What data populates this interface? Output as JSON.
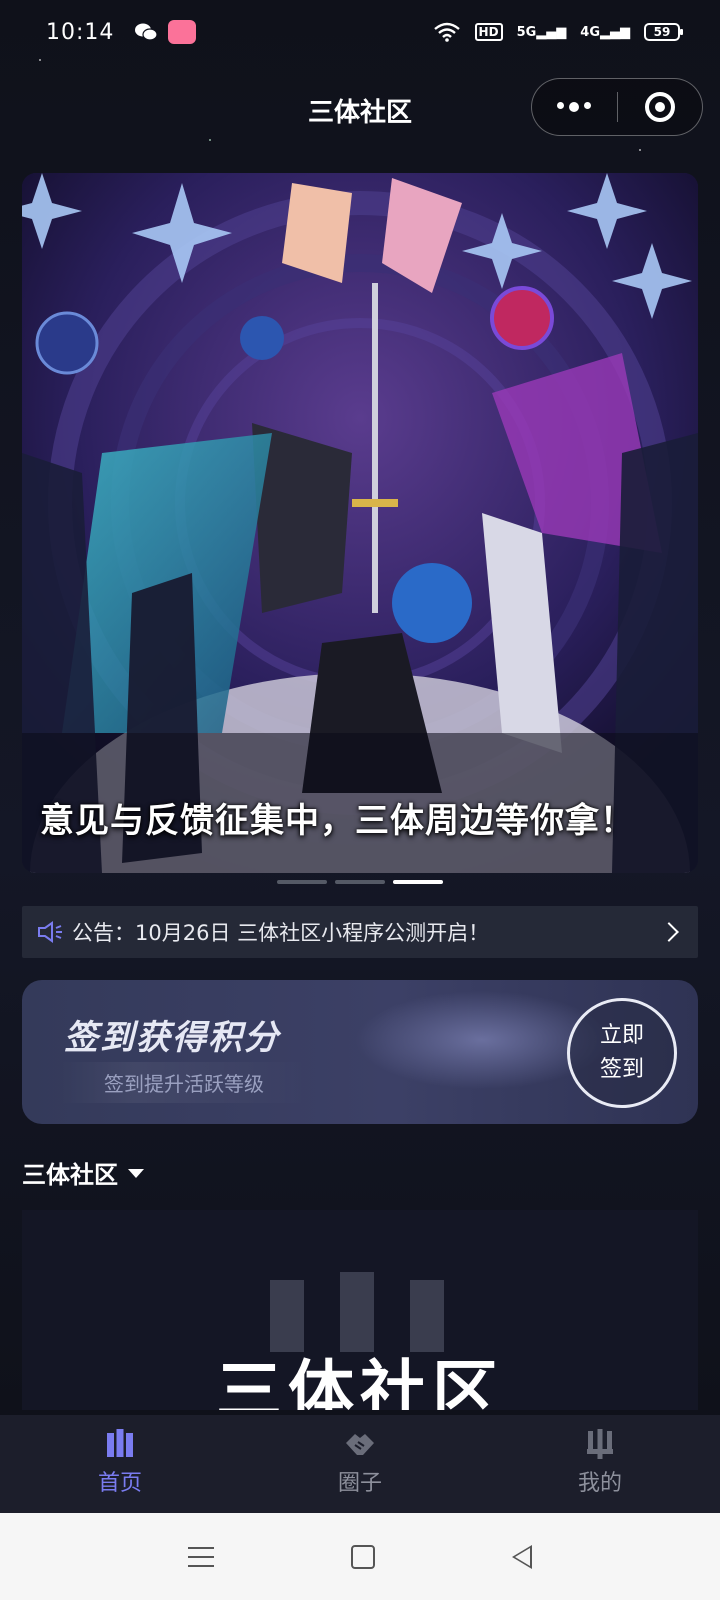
{
  "status_bar": {
    "time": "10:14",
    "network_5g": "5G",
    "network_4g": "4G",
    "hd": "HD",
    "battery": "59"
  },
  "header": {
    "title": "三体社区"
  },
  "banner": {
    "caption": "意见与反馈征集中，三体周边等你拿！",
    "dot_count": 3,
    "active_dot": 2
  },
  "notice": {
    "text": "公告：10月26日 三体社区小程序公测开启！"
  },
  "checkin": {
    "title": "签到获得积分",
    "subtitle": "签到提升活跃等级",
    "button_line1": "立即",
    "button_line2": "签到"
  },
  "community": {
    "selector_label": "三体社区",
    "card_logo_text": "三体社区"
  },
  "tab_bar": {
    "tabs": [
      {
        "label": "首页",
        "icon": "home-bars-icon",
        "active": true
      },
      {
        "label": "圈子",
        "icon": "handshake-icon",
        "active": false
      },
      {
        "label": "我的",
        "icon": "profile-trident-icon",
        "active": false
      }
    ],
    "active_color": "#7a7cf0",
    "inactive_color": "#8d909c"
  },
  "colors": {
    "background": "#10121c",
    "notice_bg": "#252937",
    "tab_bar_bg": "#1c1e2b"
  }
}
